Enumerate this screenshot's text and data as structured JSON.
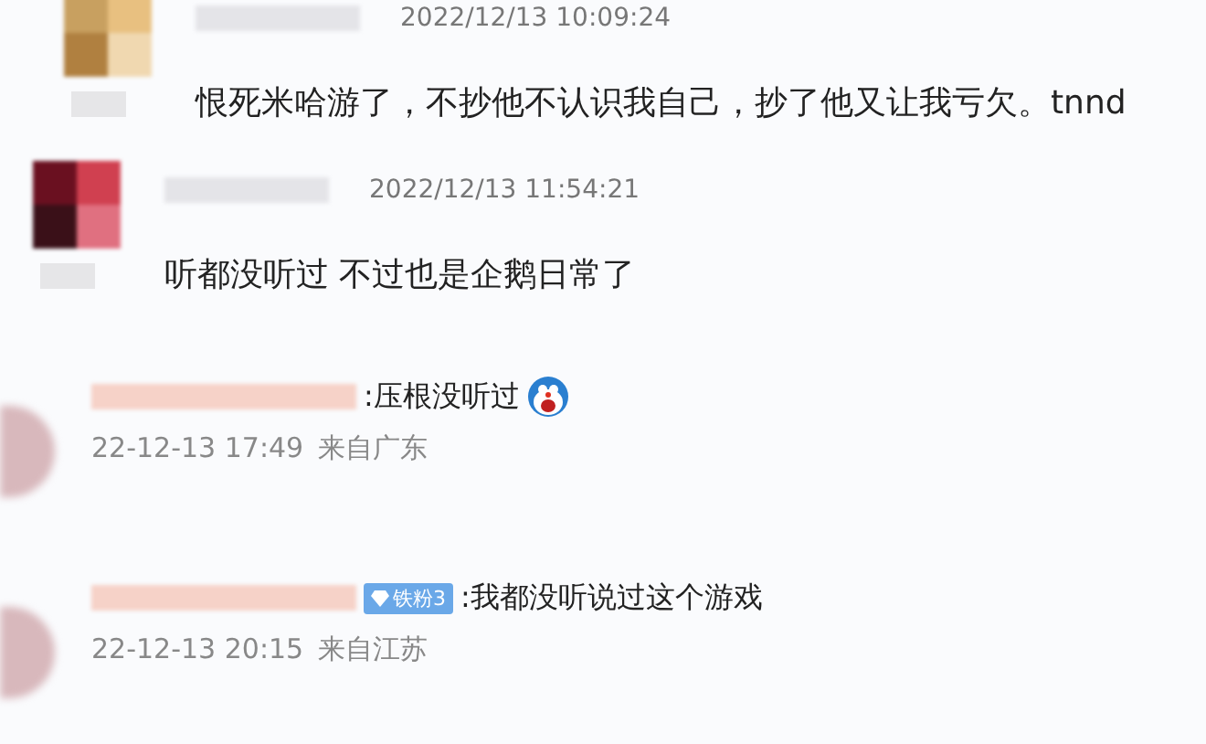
{
  "comments": [
    {
      "kind": "comment",
      "time": "2022/12/13 10:09:24",
      "text": "恨死米哈游了，不抄他不认识我自己，抄了他又让我亏欠。tnnd"
    },
    {
      "kind": "comment",
      "time": "2022/12/13 11:54:21",
      "text": "听都没听过 不过也是企鹅日常了"
    },
    {
      "kind": "reply",
      "text": ":压根没听过",
      "emoji": true,
      "time": "22-12-13 17:49",
      "location": "来自广东"
    },
    {
      "kind": "reply",
      "badge": "铁粉3",
      "text": ":我都没听说过这个游戏",
      "emoji": false,
      "time": "22-12-13 20:15",
      "location": "来自江苏"
    }
  ]
}
